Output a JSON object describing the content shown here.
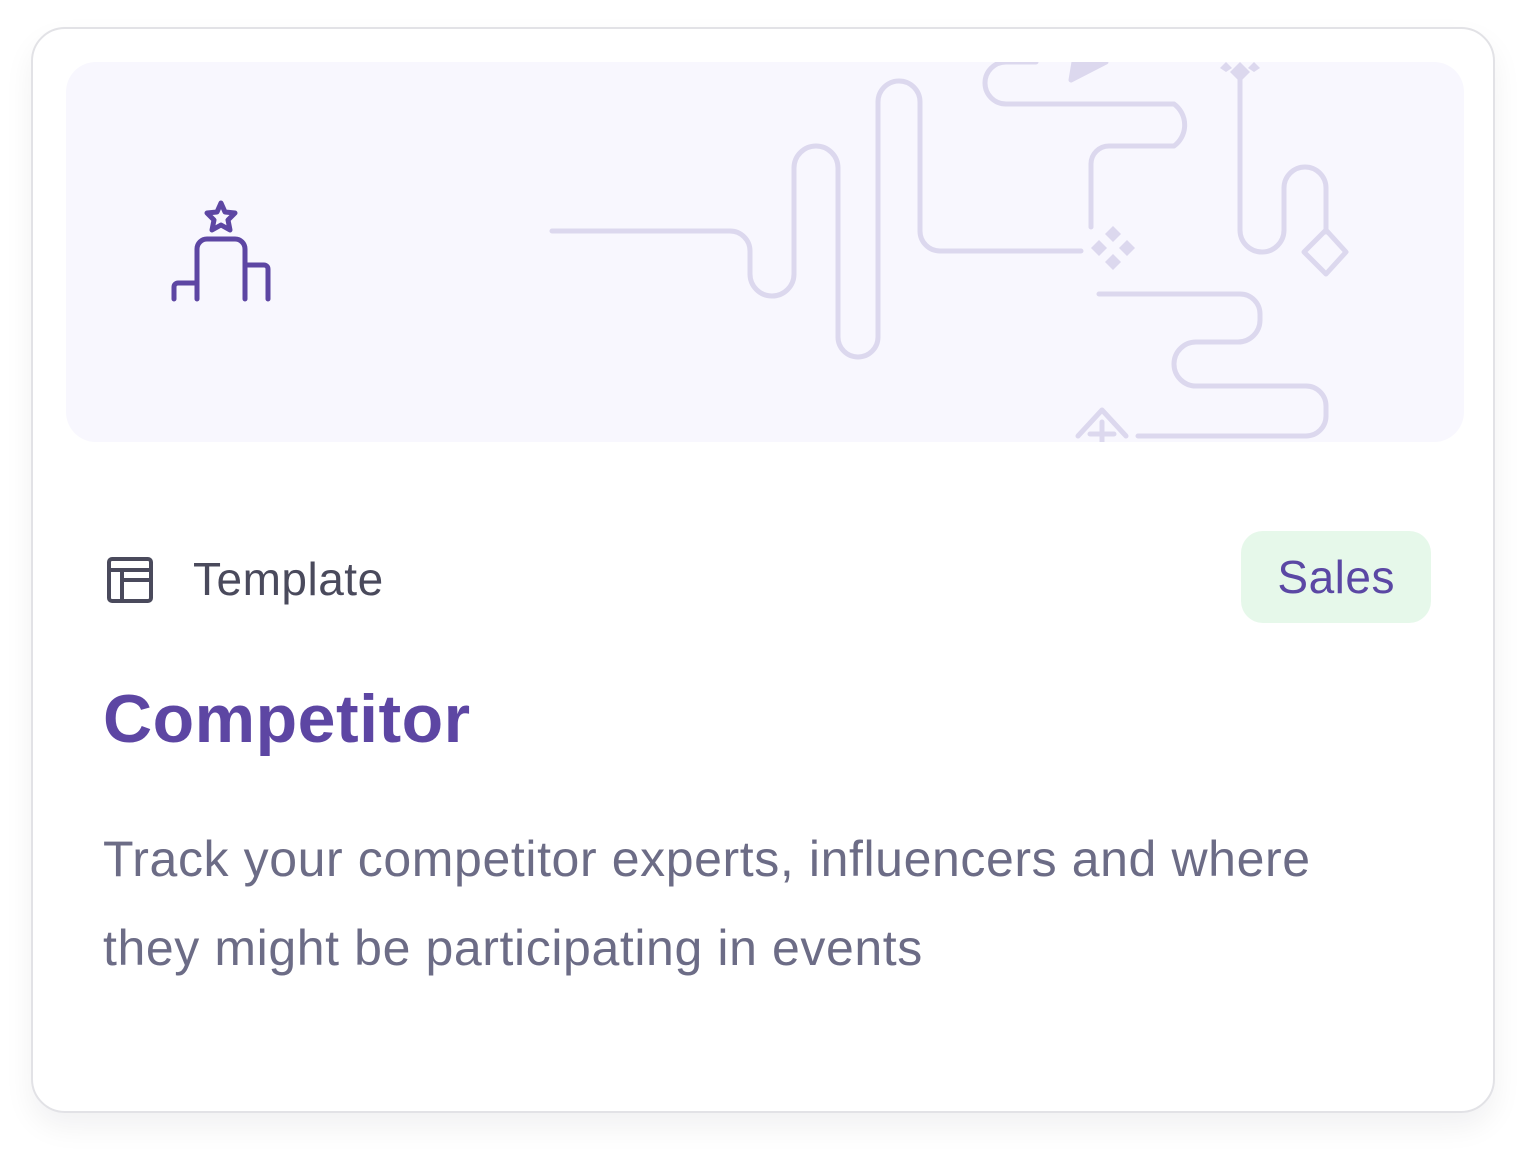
{
  "card": {
    "icon": "podium-star-icon",
    "type_icon": "template-layout-icon",
    "type_label": "Template",
    "badge": "Sales",
    "title": "Competitor",
    "description": "Track your competitor experts, influencers and where they might be participating in events"
  },
  "colors": {
    "accent": "#5d46a3",
    "badge_bg": "#e6f8ea",
    "badge_text": "#5b48a4",
    "banner_bg": "#f8f7fe",
    "decor_line": "#dcd8ee"
  }
}
